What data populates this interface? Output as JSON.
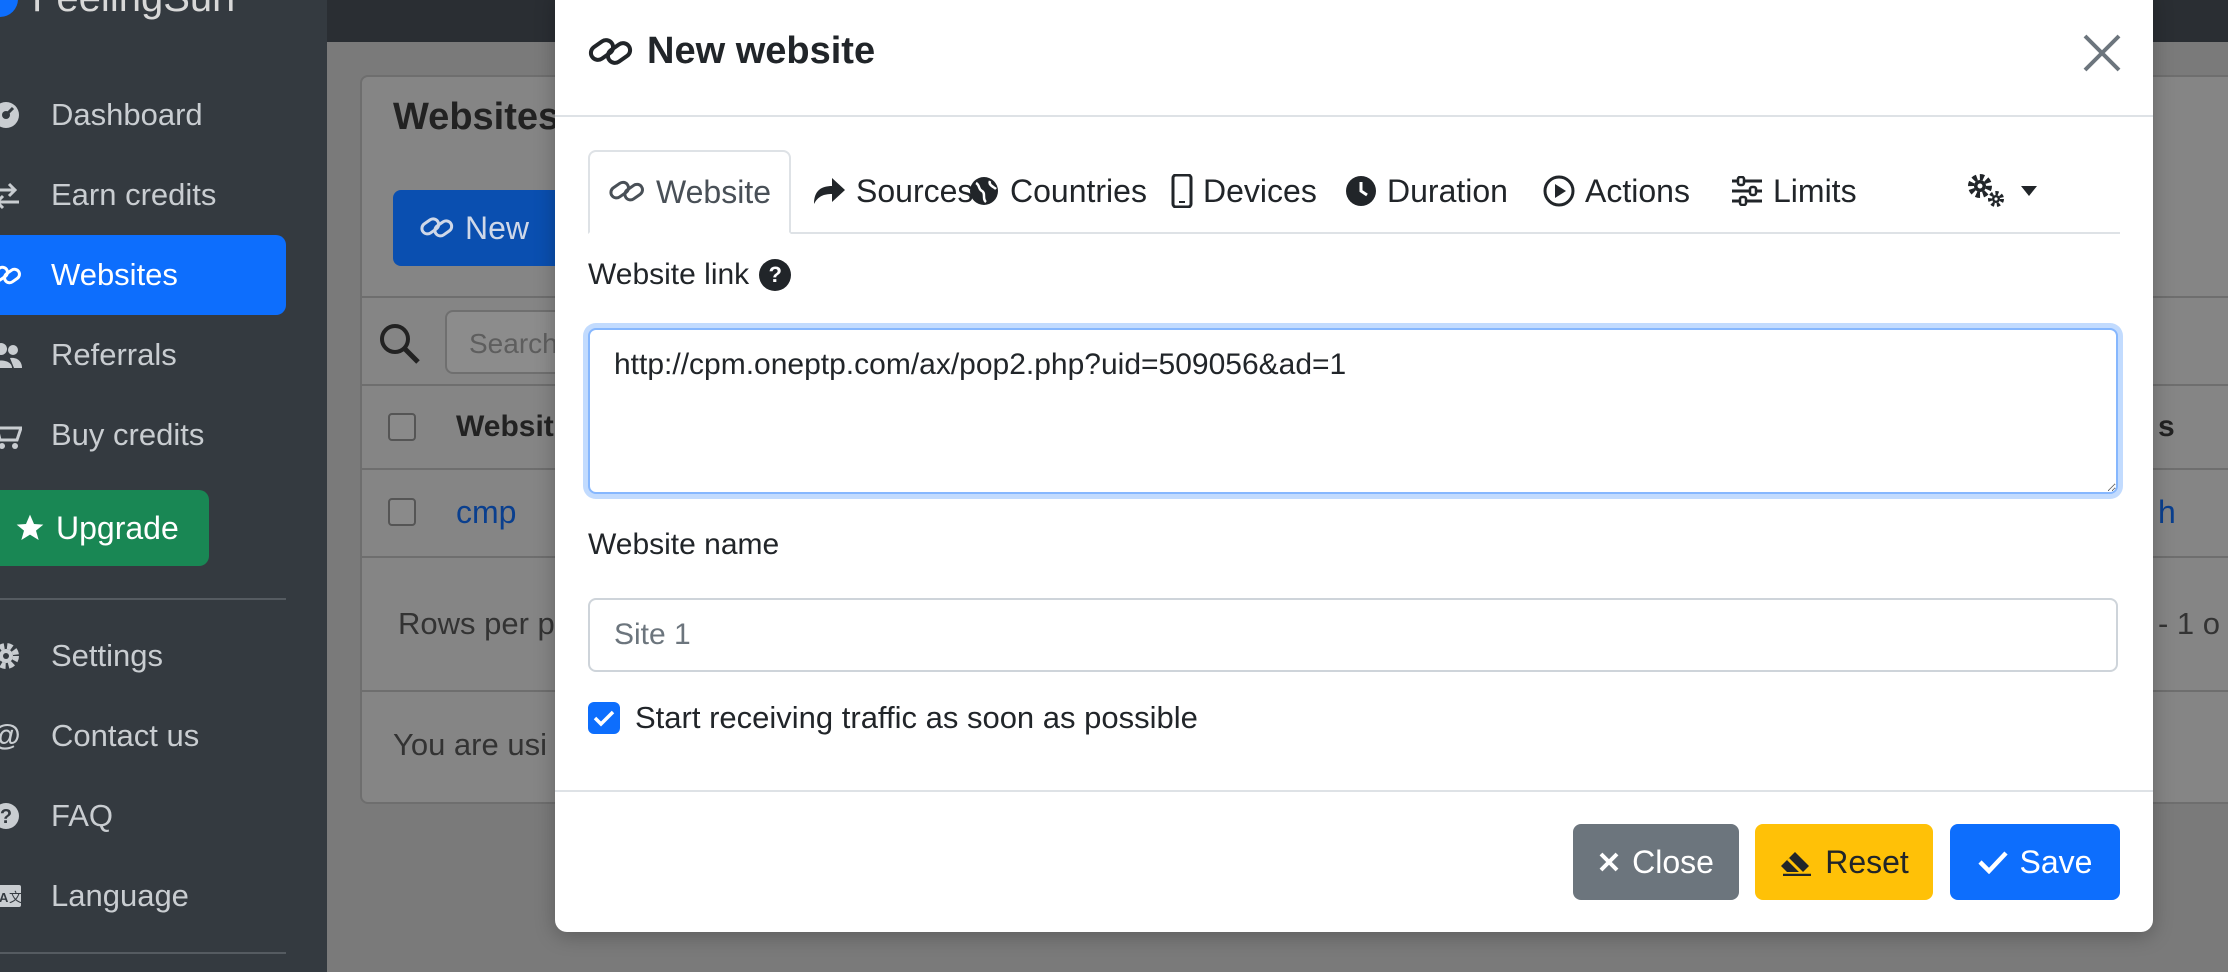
{
  "brand": {
    "name": "FeelingSurf"
  },
  "sidebar": {
    "items": [
      {
        "label": "Dashboard",
        "icon": "gauge-icon"
      },
      {
        "label": "Earn credits",
        "icon": "exchange-icon"
      },
      {
        "label": "Websites",
        "icon": "link-icon",
        "active": true
      },
      {
        "label": "Referrals",
        "icon": "users-icon"
      },
      {
        "label": "Buy credits",
        "icon": "cart-icon"
      },
      {
        "label": "Settings",
        "icon": "gear-icon"
      },
      {
        "label": "Contact us",
        "icon": "at-icon"
      },
      {
        "label": "FAQ",
        "icon": "question-icon"
      },
      {
        "label": "Language",
        "icon": "language-icon"
      }
    ],
    "upgrade_label": "Upgrade"
  },
  "page": {
    "card_title": "Websites",
    "new_button": "New",
    "search_placeholder": "Search",
    "table": {
      "header_website": "Websit",
      "header_right": "s",
      "row_name": "cmp",
      "row_right": "h"
    },
    "rows_per_page": "Rows per p",
    "pagination": "- 1 o",
    "footer_text": "You are usi"
  },
  "modal": {
    "title": "New website",
    "tabs": [
      {
        "label": "Website",
        "icon": "link-icon",
        "active": true
      },
      {
        "label": "Sources",
        "icon": "share-icon"
      },
      {
        "label": "Countries",
        "icon": "globe-icon"
      },
      {
        "label": "Devices",
        "icon": "mobile-icon"
      },
      {
        "label": "Duration",
        "icon": "clock-icon"
      },
      {
        "label": "Actions",
        "icon": "play-circle-icon"
      },
      {
        "label": "Limits",
        "icon": "sliders-icon"
      }
    ],
    "website_link_label": "Website link",
    "website_link_value": "http://cpm.oneptp.com/ax/pop2.php?uid=509056&ad=1",
    "website_name_label": "Website name",
    "website_name_placeholder": "Site 1",
    "checkbox_label": "Start receiving traffic as soon as possible",
    "checkbox_checked": true,
    "buttons": {
      "close": "Close",
      "reset": "Reset",
      "save": "Save"
    }
  },
  "colors": {
    "primary": "#0d6efd",
    "success": "#198754",
    "warning": "#ffc107",
    "secondary": "#6c757d",
    "sidebar": "#343a40"
  }
}
